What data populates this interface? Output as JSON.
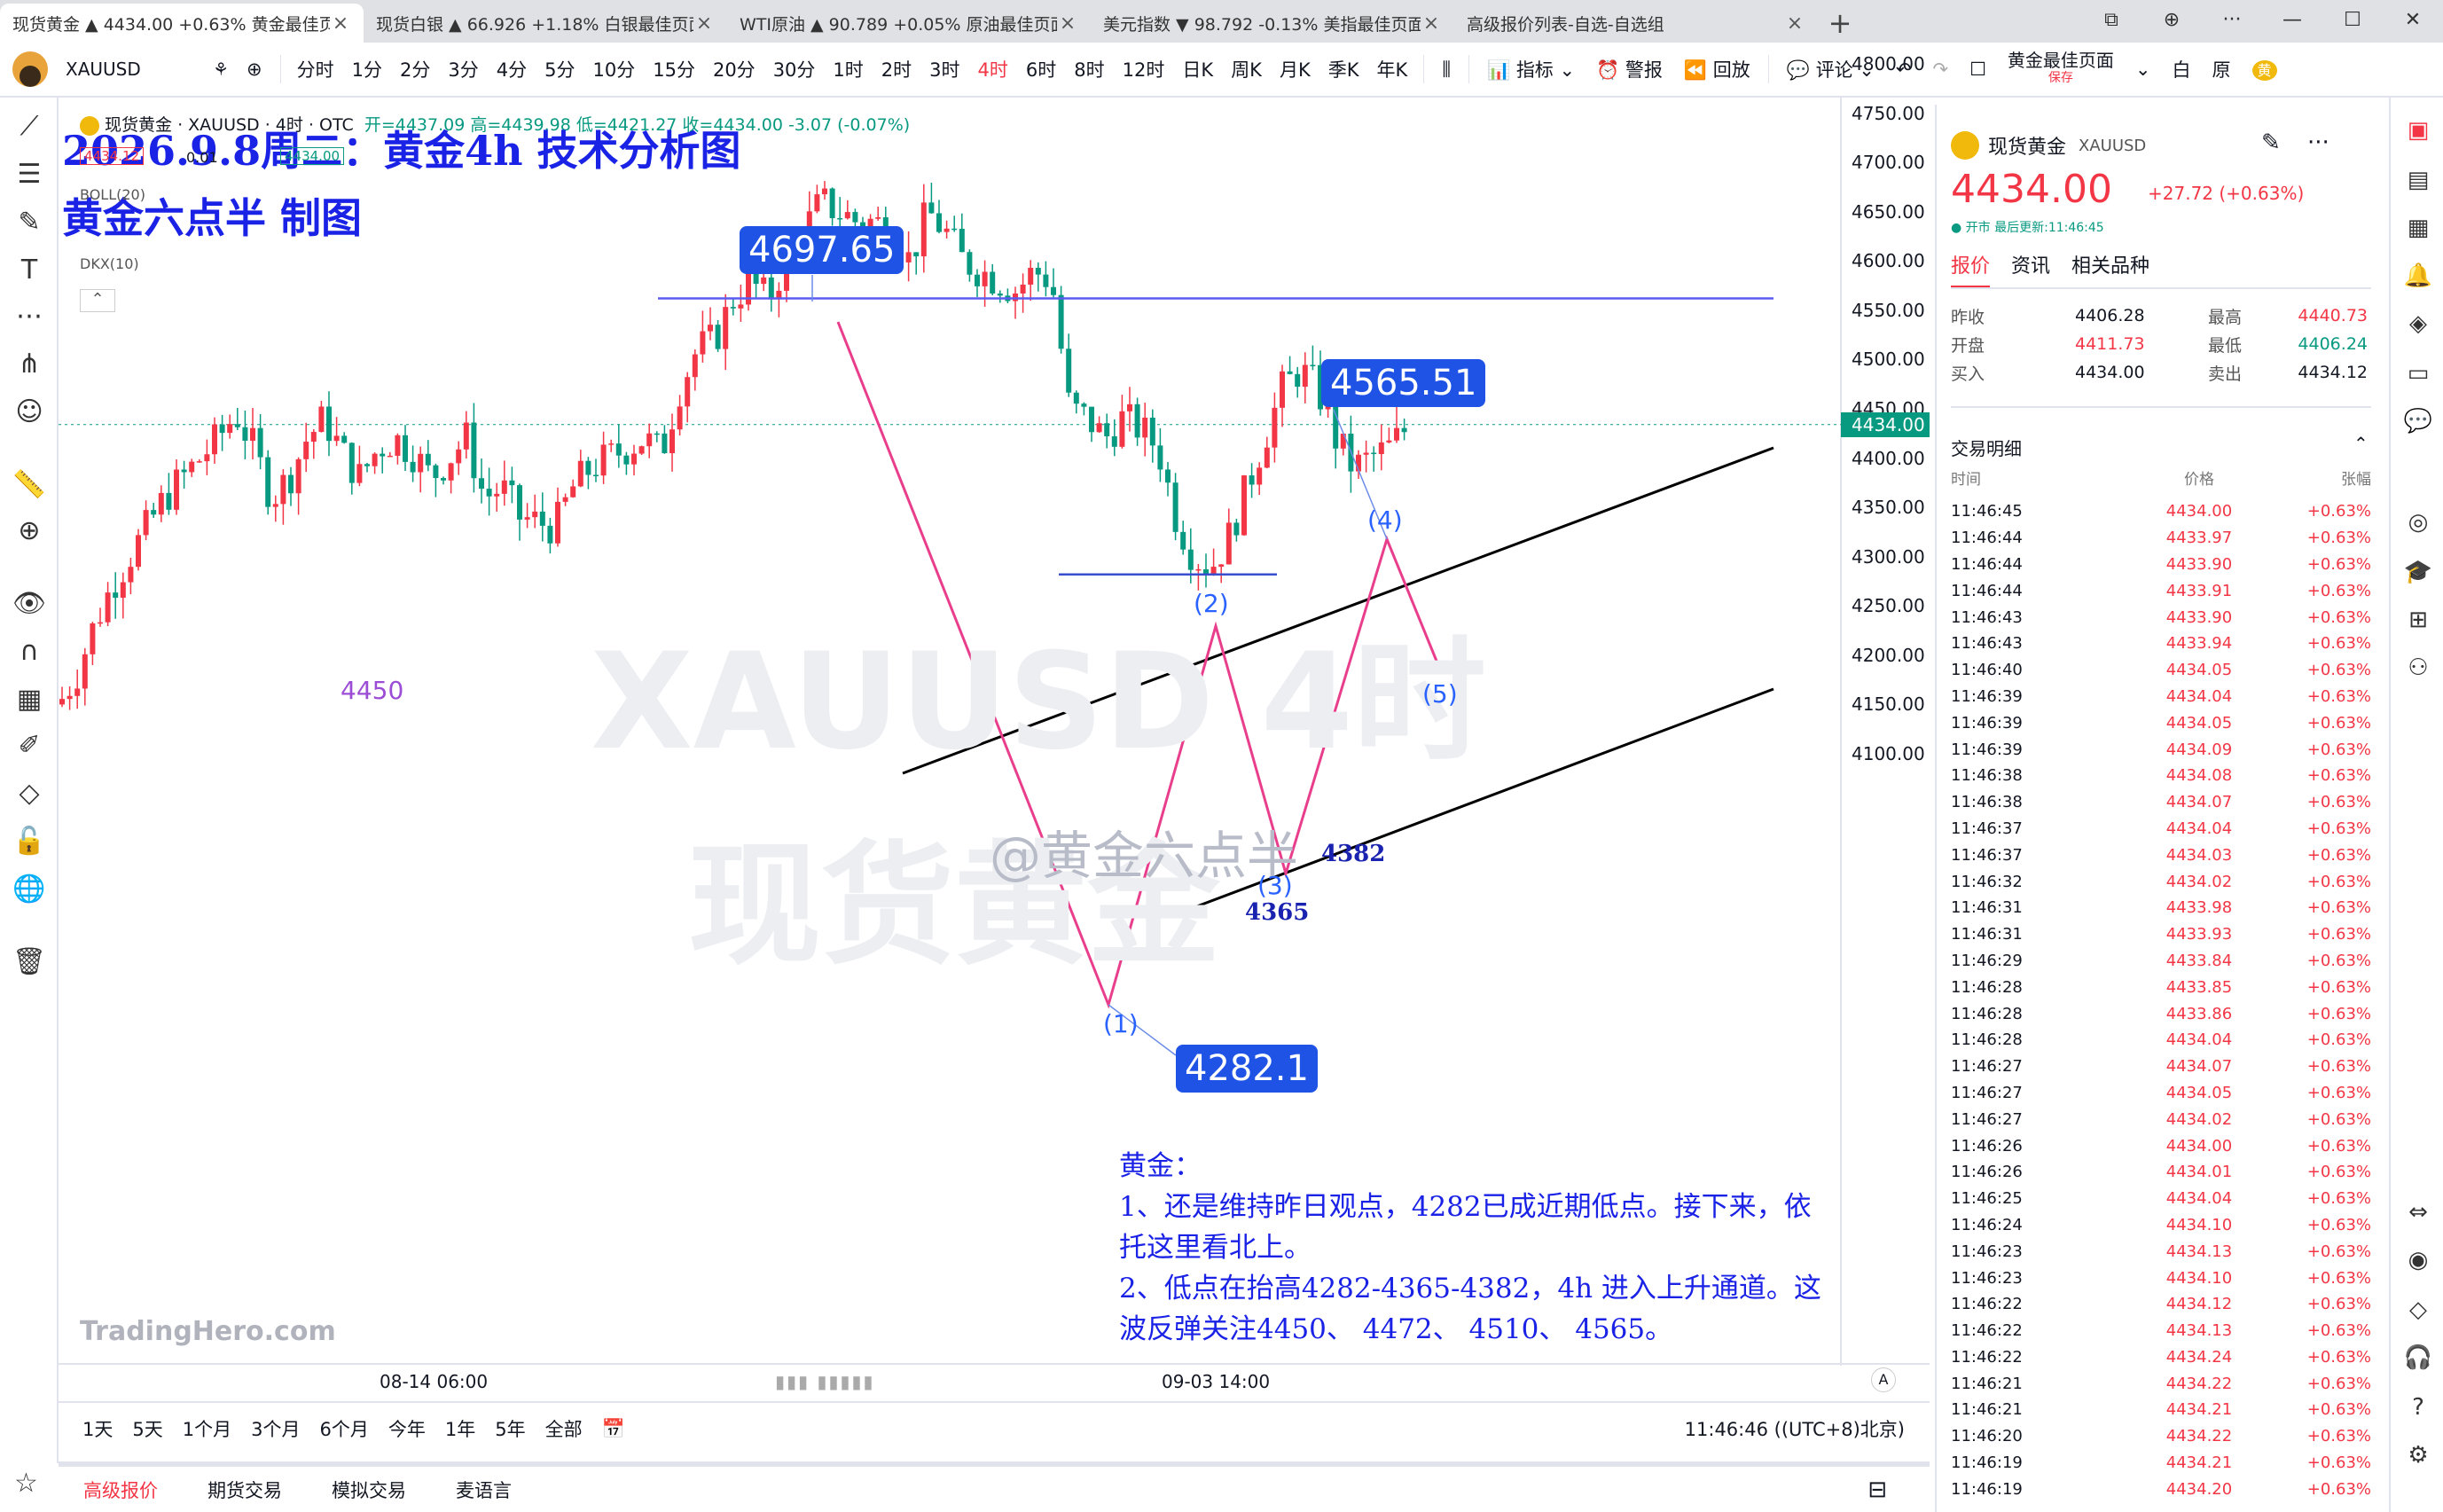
{
  "tabs": [
    {
      "label": "现货黄金  ▲ 4434.00 +0.63% 黄金最佳页面",
      "active": true
    },
    {
      "label": "现货白银  ▲ 66.926 +1.18% 白银最佳页面",
      "active": false
    },
    {
      "label": "WTI原油  ▲ 90.789 +0.05% 原油最佳页面",
      "active": false
    },
    {
      "label": "美元指数  ▼ 98.792 -0.13% 美指最佳页面",
      "active": false
    },
    {
      "label": "高级报价列表-自选-自选组",
      "active": false
    }
  ],
  "window_controls": [
    "⧉",
    "⊕",
    "···",
    "—",
    "☐",
    "✕"
  ],
  "toolbar": {
    "symbol": "XAUUSD",
    "intervals": [
      "分时",
      "1分",
      "2分",
      "3分",
      "4分",
      "5分",
      "10分",
      "15分",
      "20分",
      "30分",
      "1时",
      "2时",
      "3时",
      "4时",
      "6时",
      "8时",
      "12时",
      "日K",
      "周K",
      "月K",
      "季K",
      "年K"
    ],
    "active_interval": "4时",
    "indicators": "指标",
    "alerts": "警报",
    "replay": "回放",
    "comment": "评论",
    "layout_name": "黄金最佳页面",
    "layout_saved": "保存",
    "theme_white": "白",
    "theme_orig": "原",
    "user_badge": "黄"
  },
  "chart": {
    "title": "2026.9.8周二：黄金4h 技术分析图",
    "subtitle": "黄金六点半        制图",
    "ohlc_symbol": "现货黄金 · XAUUSD · 4时 · OTC",
    "ohlc_values": "开=4437.09  高=4439.98  低=4421.27  收=4434.00  -3.07 (-0.07%)",
    "indicator_boll": "BOLL(20)",
    "indicator_dkx": "DKX(10)",
    "mini_values": [
      "4434.12",
      "0.01",
      "4434.00"
    ],
    "watermark_symbol": "XAUUSD 4时",
    "watermark_name": "现货黄金",
    "watermark_weibo": "@黄金六点半",
    "brand": "TradingHero.com",
    "price_labels": {
      "high": "4697.65",
      "target": "4565.51",
      "low": "4282.1"
    },
    "level_4450": "4450",
    "waves": [
      "(1)",
      "(2)",
      "(3)",
      "(4)",
      "(5)"
    ],
    "lows": {
      "first": "4365",
      "second": "4382"
    },
    "note_title": "黄金：",
    "note_line1": "1、还是维持昨日观点，4282已成近期低点。接下来，依托这里看北上。",
    "note_line2": "2、低点在抬高4282-4365-4382，4h 进入上升通道。这波反弹关注4450、 4472、 4510、 4565。",
    "last_price_tag": "4434.00",
    "y_axis": [
      "4800.00",
      "4750.00",
      "4700.00",
      "4650.00",
      "4600.00",
      "4550.00",
      "4500.00",
      "4450.00",
      "4400.00",
      "4350.00",
      "4300.00",
      "4250.00",
      "4200.00",
      "4150.00",
      "4100.00"
    ],
    "x_axis": [
      "08-14 06:00",
      "09-03 14:00"
    ],
    "auto_scale": "A"
  },
  "chart_data": {
    "type": "candlestick",
    "title": "2026.9.8周二：黄金4h 技术分析图",
    "ylim": [
      4080,
      4805
    ],
    "annotations": {
      "high": 4697.65,
      "target": 4565.51,
      "low": 4282.1,
      "lows_sequence": [
        4282,
        4365,
        4382
      ],
      "watch_levels": [
        4450,
        4472,
        4510,
        4565
      ]
    },
    "last": 4434.0
  },
  "range_bar": {
    "ranges": [
      "1天",
      "5天",
      "1个月",
      "3个月",
      "6个月",
      "今年",
      "1年",
      "5年",
      "全部"
    ],
    "time": "11:46:46 ((UTC+8)北京)"
  },
  "footer_tabs": [
    "高级报价",
    "期货交易",
    "模拟交易",
    "麦语言"
  ],
  "panel": {
    "name": "现货黄金",
    "code": "XAUUSD",
    "price": "4434.00",
    "change": "+27.72 (+0.63%)",
    "status": "● 开市 最后更新:11:46:45",
    "tabs": [
      "报价",
      "资讯",
      "相关品种"
    ],
    "stats": [
      {
        "l1": "昨收",
        "v1": "4406.28",
        "l2": "最高",
        "v2": "4440.73",
        "c1": "",
        "c2": "red"
      },
      {
        "l1": "开盘",
        "v1": "4411.73",
        "l2": "最低",
        "v2": "4406.24",
        "c1": "red",
        "c2": "grn"
      },
      {
        "l1": "买入",
        "v1": "4434.00",
        "l2": "卖出",
        "v2": "4434.12",
        "c1": "",
        "c2": ""
      }
    ],
    "trades_title": "交易明细",
    "trades_head": [
      "时间",
      "价格",
      "张幅"
    ],
    "trades": [
      [
        "11:46:45",
        "4434.00"
      ],
      [
        "11:46:44",
        "4433.97"
      ],
      [
        "11:46:44",
        "4433.90"
      ],
      [
        "11:46:44",
        "4433.91"
      ],
      [
        "11:46:43",
        "4433.90"
      ],
      [
        "11:46:43",
        "4433.94"
      ],
      [
        "11:46:40",
        "4434.05"
      ],
      [
        "11:46:39",
        "4434.04"
      ],
      [
        "11:46:39",
        "4434.05"
      ],
      [
        "11:46:39",
        "4434.09"
      ],
      [
        "11:46:38",
        "4434.08"
      ],
      [
        "11:46:38",
        "4434.07"
      ],
      [
        "11:46:37",
        "4434.04"
      ],
      [
        "11:46:37",
        "4434.03"
      ],
      [
        "11:46:32",
        "4434.02"
      ],
      [
        "11:46:31",
        "4433.98"
      ],
      [
        "11:46:31",
        "4433.93"
      ],
      [
        "11:46:29",
        "4433.84"
      ],
      [
        "11:46:28",
        "4433.85"
      ],
      [
        "11:46:28",
        "4433.86"
      ],
      [
        "11:46:28",
        "4434.04"
      ],
      [
        "11:46:27",
        "4434.07"
      ],
      [
        "11:46:27",
        "4434.05"
      ],
      [
        "11:46:27",
        "4434.02"
      ],
      [
        "11:46:26",
        "4434.00"
      ],
      [
        "11:46:26",
        "4434.01"
      ],
      [
        "11:46:25",
        "4434.04"
      ],
      [
        "11:46:24",
        "4434.10"
      ],
      [
        "11:46:23",
        "4434.13"
      ],
      [
        "11:46:23",
        "4434.10"
      ],
      [
        "11:46:22",
        "4434.12"
      ],
      [
        "11:46:22",
        "4434.13"
      ],
      [
        "11:46:22",
        "4434.24"
      ],
      [
        "11:46:21",
        "4434.22"
      ],
      [
        "11:46:21",
        "4434.21"
      ],
      [
        "11:46:20",
        "4434.22"
      ],
      [
        "11:46:19",
        "4434.21"
      ],
      [
        "11:46:19",
        "4434.20"
      ]
    ],
    "trade_change": "+0.63%"
  }
}
